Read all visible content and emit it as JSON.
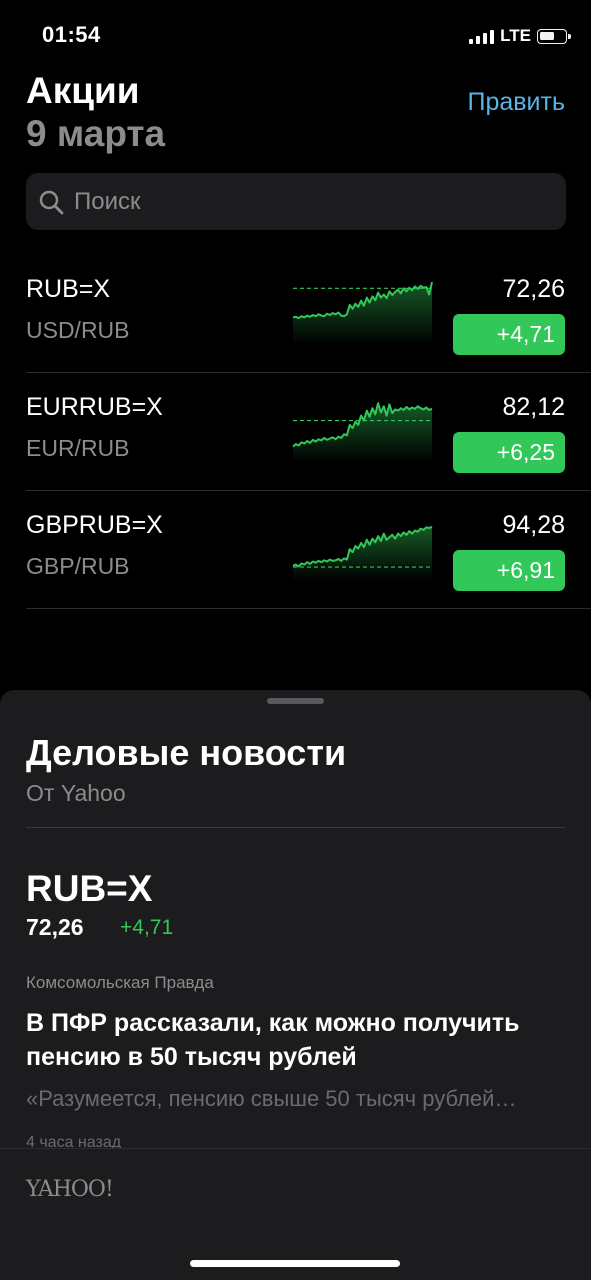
{
  "status_bar": {
    "time": "01:54",
    "network": "LTE"
  },
  "header": {
    "title": "Акции",
    "date": "9 марта",
    "edit_label": "Править"
  },
  "search": {
    "placeholder": "Поиск"
  },
  "colors": {
    "positive": "#32c759",
    "accent": "#5ab4e6"
  },
  "stocks": [
    {
      "symbol": "RUB=X",
      "pair": "USD/RUB",
      "price": "72,26",
      "change": "+4,71",
      "sparkline": [
        0.38,
        0.39,
        0.37,
        0.4,
        0.38,
        0.41,
        0.39,
        0.42,
        0.4,
        0.43,
        0.41,
        0.4,
        0.44,
        0.42,
        0.45,
        0.43,
        0.46,
        0.41,
        0.4,
        0.43,
        0.58,
        0.52,
        0.6,
        0.55,
        0.65,
        0.57,
        0.7,
        0.62,
        0.72,
        0.66,
        0.78,
        0.7,
        0.75,
        0.69,
        0.8,
        0.74,
        0.79,
        0.83,
        0.77,
        0.85,
        0.8,
        0.86,
        0.82,
        0.88,
        0.84,
        0.89,
        0.86,
        0.87,
        0.75,
        0.95
      ],
      "baseline": 0.85
    },
    {
      "symbol": "EURRUB=X",
      "pair": "EUR/RUB",
      "price": "82,12",
      "change": "+6,25",
      "sparkline": [
        0.2,
        0.24,
        0.22,
        0.27,
        0.25,
        0.29,
        0.26,
        0.31,
        0.28,
        0.32,
        0.3,
        0.34,
        0.31,
        0.33,
        0.35,
        0.32,
        0.36,
        0.34,
        0.4,
        0.38,
        0.55,
        0.5,
        0.6,
        0.55,
        0.7,
        0.62,
        0.78,
        0.68,
        0.82,
        0.72,
        0.9,
        0.75,
        0.85,
        0.7,
        0.88,
        0.74,
        0.8,
        0.78,
        0.82,
        0.79,
        0.84,
        0.8,
        0.83,
        0.81,
        0.85,
        0.82,
        0.8,
        0.83,
        0.79,
        0.81
      ],
      "baseline": 0.62
    },
    {
      "symbol": "GBPRUB=X",
      "pair": "GBP/RUB",
      "price": "94,28",
      "change": "+6,91",
      "sparkline": [
        0.18,
        0.2,
        0.17,
        0.22,
        0.2,
        0.24,
        0.21,
        0.25,
        0.23,
        0.26,
        0.24,
        0.27,
        0.25,
        0.28,
        0.26,
        0.27,
        0.29,
        0.26,
        0.3,
        0.28,
        0.45,
        0.4,
        0.5,
        0.46,
        0.55,
        0.48,
        0.6,
        0.52,
        0.62,
        0.56,
        0.66,
        0.58,
        0.7,
        0.6,
        0.64,
        0.68,
        0.62,
        0.7,
        0.66,
        0.72,
        0.68,
        0.74,
        0.7,
        0.75,
        0.73,
        0.78,
        0.76,
        0.8,
        0.79,
        0.81
      ],
      "baseline": 0.16
    }
  ],
  "news": {
    "title": "Деловые новости",
    "source": "От Yahoo",
    "ticker": {
      "symbol": "RUB=X",
      "price": "72,26",
      "change": "+4,71"
    },
    "article": {
      "publisher": "Комсомольская Правда",
      "headline": "В ПФР рассказали, как можно получить пенсию в 50 тысяч рублей",
      "snippet": "«Разумеется, пенсию свыше 50 тысяч рублей…",
      "time": "4 часа назад"
    },
    "footer_logo": "YAHOO!"
  }
}
